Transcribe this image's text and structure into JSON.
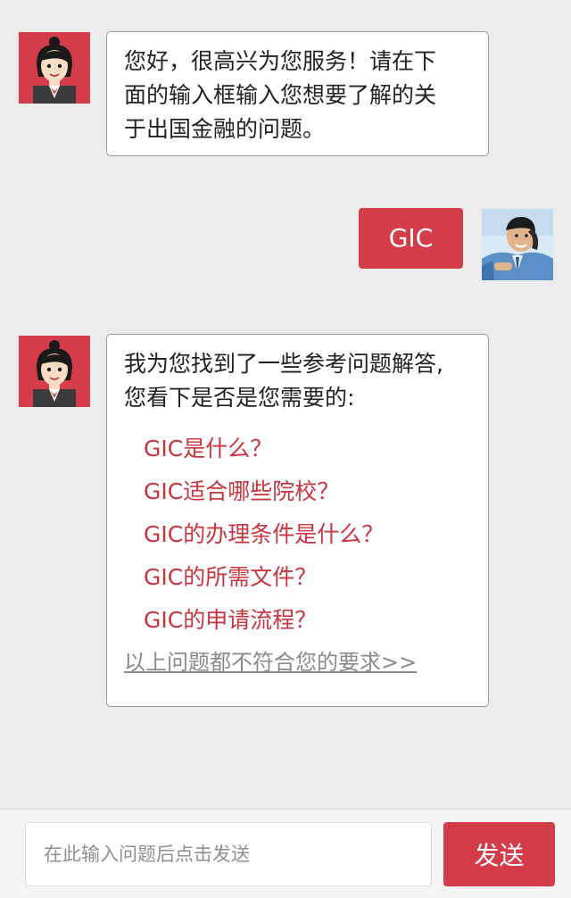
{
  "colors": {
    "accent": "#d43c49",
    "link_red": "#c9343f",
    "background": "#ececec"
  },
  "messages": [
    {
      "from": "bot",
      "avatar_icon": "assistant-girl-avatar",
      "lines": [
        "您好，很高兴为您服务！请在下",
        "面的输入框输入您想要了解的关",
        "于出国金融的问题。"
      ]
    },
    {
      "from": "user",
      "avatar_icon": "user-photo-avatar",
      "text": "GIC"
    },
    {
      "from": "bot",
      "avatar_icon": "assistant-girl-avatar",
      "lines": [
        "我为您找到了一些参考问题解答,",
        "您看下是否是您需要的:"
      ],
      "options": [
        "GIC是什么？",
        "GIC适合哪些院校？",
        "GIC的办理条件是什么？",
        "GIC的所需文件？",
        "GIC的申请流程？"
      ],
      "none_match_link": "以上问题都不符合您的要求>>"
    }
  ],
  "input": {
    "placeholder": "在此输入问题后点击发送",
    "value": ""
  },
  "send_button": {
    "label": "发送"
  }
}
